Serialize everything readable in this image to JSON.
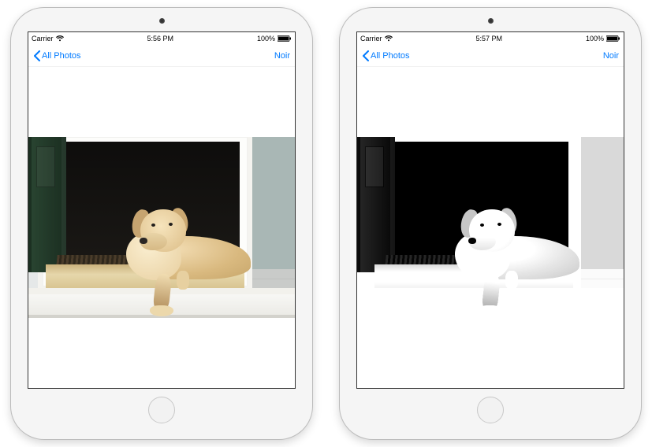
{
  "devices": [
    {
      "status": {
        "carrier": "Carrier",
        "time": "5:56 PM",
        "battery": "100%"
      },
      "nav": {
        "back_label": "All Photos",
        "action_label": "Noir"
      },
      "filter": "none"
    },
    {
      "status": {
        "carrier": "Carrier",
        "time": "5:57 PM",
        "battery": "100%"
      },
      "nav": {
        "back_label": "All Photos",
        "action_label": "Noir"
      },
      "filter": "noir"
    }
  ],
  "colors": {
    "tint": "#007aff"
  }
}
